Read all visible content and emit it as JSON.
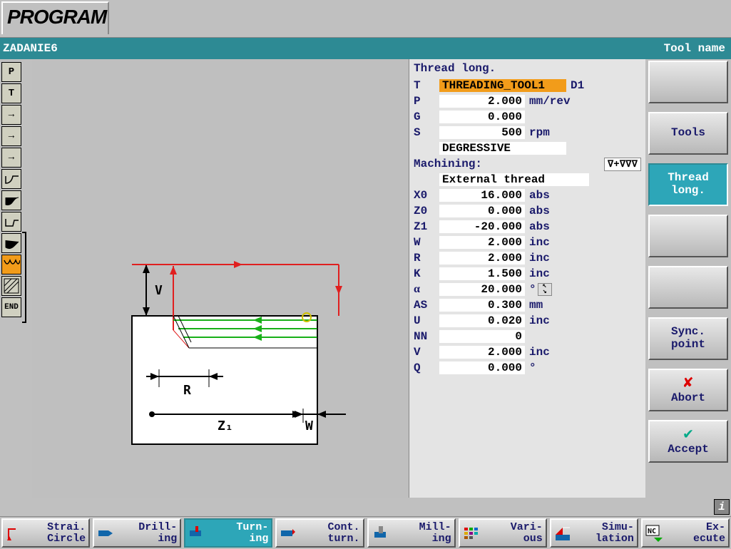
{
  "header": {
    "program_tab": "PROGRAM",
    "file_name": "ZADANIE6",
    "right_label": "Tool name"
  },
  "left_toolbar": [
    {
      "label": "P",
      "type": "text"
    },
    {
      "label": "T",
      "type": "text"
    },
    {
      "label": "→",
      "type": "arrow"
    },
    {
      "label": "→",
      "type": "arrow"
    },
    {
      "label": "→",
      "type": "arrow"
    },
    {
      "glyph": "curve1"
    },
    {
      "glyph": "curve2"
    },
    {
      "glyph": "curve3"
    },
    {
      "glyph": "curve4"
    },
    {
      "glyph": "thread",
      "selected": true
    },
    {
      "glyph": "hatch"
    },
    {
      "label": "END",
      "type": "text",
      "small": true
    }
  ],
  "diagram_labels": {
    "V": "V",
    "R": "R",
    "Z1": "Z₁",
    "W": "W"
  },
  "panel": {
    "title": "Thread long.",
    "tool": {
      "label": "T",
      "name": "THREADING_TOOL1",
      "d": "D1"
    },
    "rows_top": [
      {
        "label": "P",
        "value": "2.000",
        "unit": "mm/rev"
      },
      {
        "label": "G",
        "value": "0.000",
        "unit": ""
      },
      {
        "label": "S",
        "value": "500",
        "unit": "rpm"
      }
    ],
    "infeed_mode": "DEGRESSIVE",
    "machining_label": "Machining:",
    "machining_symbol": "∇+∇∇∇",
    "thread_type": "External thread",
    "rows": [
      {
        "label": "X0",
        "value": "16.000",
        "unit": "abs"
      },
      {
        "label": "Z0",
        "value": "0.000",
        "unit": "abs"
      },
      {
        "label": "Z1",
        "value": "-20.000",
        "unit": "abs"
      },
      {
        "label": "W",
        "value": "2.000",
        "unit": "inc"
      },
      {
        "label": "R",
        "value": "2.000",
        "unit": "inc"
      },
      {
        "label": "K",
        "value": "1.500",
        "unit": "inc"
      },
      {
        "label": "α",
        "value": "20.000",
        "unit": "°",
        "toggle": true
      },
      {
        "label": "AS",
        "value": "0.300",
        "unit": "mm"
      },
      {
        "label": "U",
        "value": "0.020",
        "unit": "inc"
      },
      {
        "label": "NN",
        "value": "0",
        "unit": ""
      },
      {
        "label": "V",
        "value": "2.000",
        "unit": "inc"
      },
      {
        "label": "Q",
        "value": "0.000",
        "unit": "°"
      }
    ]
  },
  "right_softkeys": [
    {
      "label": ""
    },
    {
      "label": "Tools"
    },
    {
      "label": "Thread\nlong.",
      "active": true
    },
    {
      "label": ""
    },
    {
      "label": ""
    },
    {
      "label": "Sync.\npoint"
    },
    {
      "label": "Abort",
      "icon": "x"
    },
    {
      "label": "Accept",
      "icon": "check"
    }
  ],
  "bottom_toolbar": [
    {
      "label1": "Strai.",
      "label2": "Circle",
      "icon": "strai"
    },
    {
      "label1": "Drill-",
      "label2": "ing",
      "icon": "drill"
    },
    {
      "label1": "Turn-",
      "label2": "ing",
      "icon": "turn",
      "active": true
    },
    {
      "label1": "Cont.",
      "label2": "turn.",
      "icon": "cont"
    },
    {
      "label1": "Mill-",
      "label2": "ing",
      "icon": "mill"
    },
    {
      "label1": "Vari-",
      "label2": "ous",
      "icon": "various"
    },
    {
      "label1": "Simu-",
      "label2": "lation",
      "icon": "sim"
    },
    {
      "label1": "Ex-",
      "label2": "ecute",
      "icon": "nc"
    }
  ],
  "info_icon": "i"
}
